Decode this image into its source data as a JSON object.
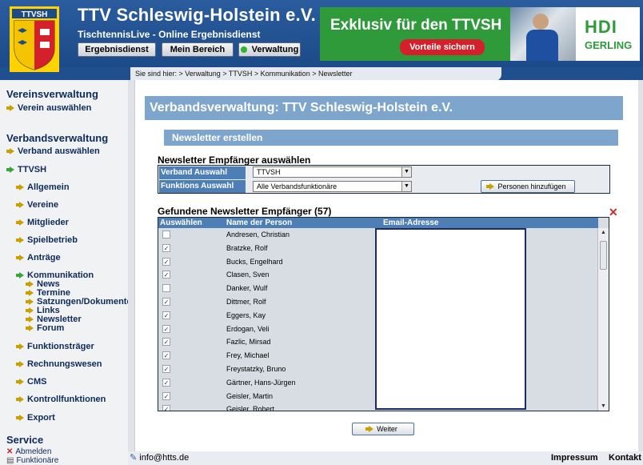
{
  "header": {
    "logo_text": "TTVSH",
    "title": "TTV Schleswig-Holstein e.V.",
    "subtitle": "TischtennisLive - Online Ergebnisdienst",
    "nav": [
      "Ergebnisdienst",
      "Mein Bereich",
      "Verwaltung"
    ]
  },
  "banner": {
    "headline": "Exklusiv für den TTVSH",
    "button": "Vorteile sichern",
    "brand_top": "HDI",
    "brand_bottom": "GERLING"
  },
  "breadcrumb": "Sie sind hier: > Verwaltung > TTVSH > Kommunikation > Newsletter",
  "sidebar": {
    "vereinsverwaltung": "Vereinsverwaltung",
    "verein_auswaehlen": "Verein auswählen",
    "verbandsverwaltung": "Verbandsverwaltung",
    "verband_auswaehlen": "Verband auswählen",
    "ttvsh": "TTVSH",
    "items": [
      "Allgemein",
      "Vereine",
      "Mitglieder",
      "Spielbetrieb",
      "Anträge",
      "Kommunikation"
    ],
    "sub": [
      "News",
      "Termine",
      "Satzungen/Dokumente",
      "Links",
      "Newsletter",
      "Forum"
    ],
    "items2": [
      "Funktionsträger",
      "Rechnungswesen",
      "CMS",
      "Kontrollfunktionen",
      "Export"
    ],
    "service": "Service",
    "abmelden": "Abmelden",
    "funktionaere": "Funktionäre"
  },
  "main": {
    "page_title": "Verbandsverwaltung: TTV Schleswig-Holstein e.V.",
    "section": "Newsletter erstellen",
    "recipients_title": "Newsletter Empfänger auswählen",
    "verband_label": "Verband Auswahl",
    "verband_value": "TTVSH",
    "funktion_label": "Funktions Auswahl",
    "funktion_value": "Alle Verbandsfunktionäre",
    "add_button": "Personen hinzufügen",
    "found_title": "Gefundene Newsletter Empfänger (57)",
    "col_select": "Auswählen",
    "col_name": "Name der Person",
    "col_email": "Email-Adresse",
    "rows": [
      {
        "name": "Andresen, Christian",
        "checked": false
      },
      {
        "name": "Bratzke, Rolf",
        "checked": true
      },
      {
        "name": "Bucks, Engelhard",
        "checked": true
      },
      {
        "name": "Clasen, Sven",
        "checked": true
      },
      {
        "name": "Danker, Wulf",
        "checked": false
      },
      {
        "name": "Dittmer, Rolf",
        "checked": true
      },
      {
        "name": "Eggers, Kay",
        "checked": true
      },
      {
        "name": "Erdogan, Veli",
        "checked": true
      },
      {
        "name": "Fazlic, Mirsad",
        "checked": true
      },
      {
        "name": "Frey, Michael",
        "checked": true
      },
      {
        "name": "Freystatzky, Bruno",
        "checked": true
      },
      {
        "name": "Gärtner, Hans-Jürgen",
        "checked": true
      },
      {
        "name": "Geisler, Martin",
        "checked": true
      },
      {
        "name": "Geisler, Robert",
        "checked": true
      }
    ],
    "next_button": "Weiter"
  },
  "footer": {
    "email": "info@htts.de",
    "impressum": "Impressum",
    "kontakt": "Kontakt"
  }
}
